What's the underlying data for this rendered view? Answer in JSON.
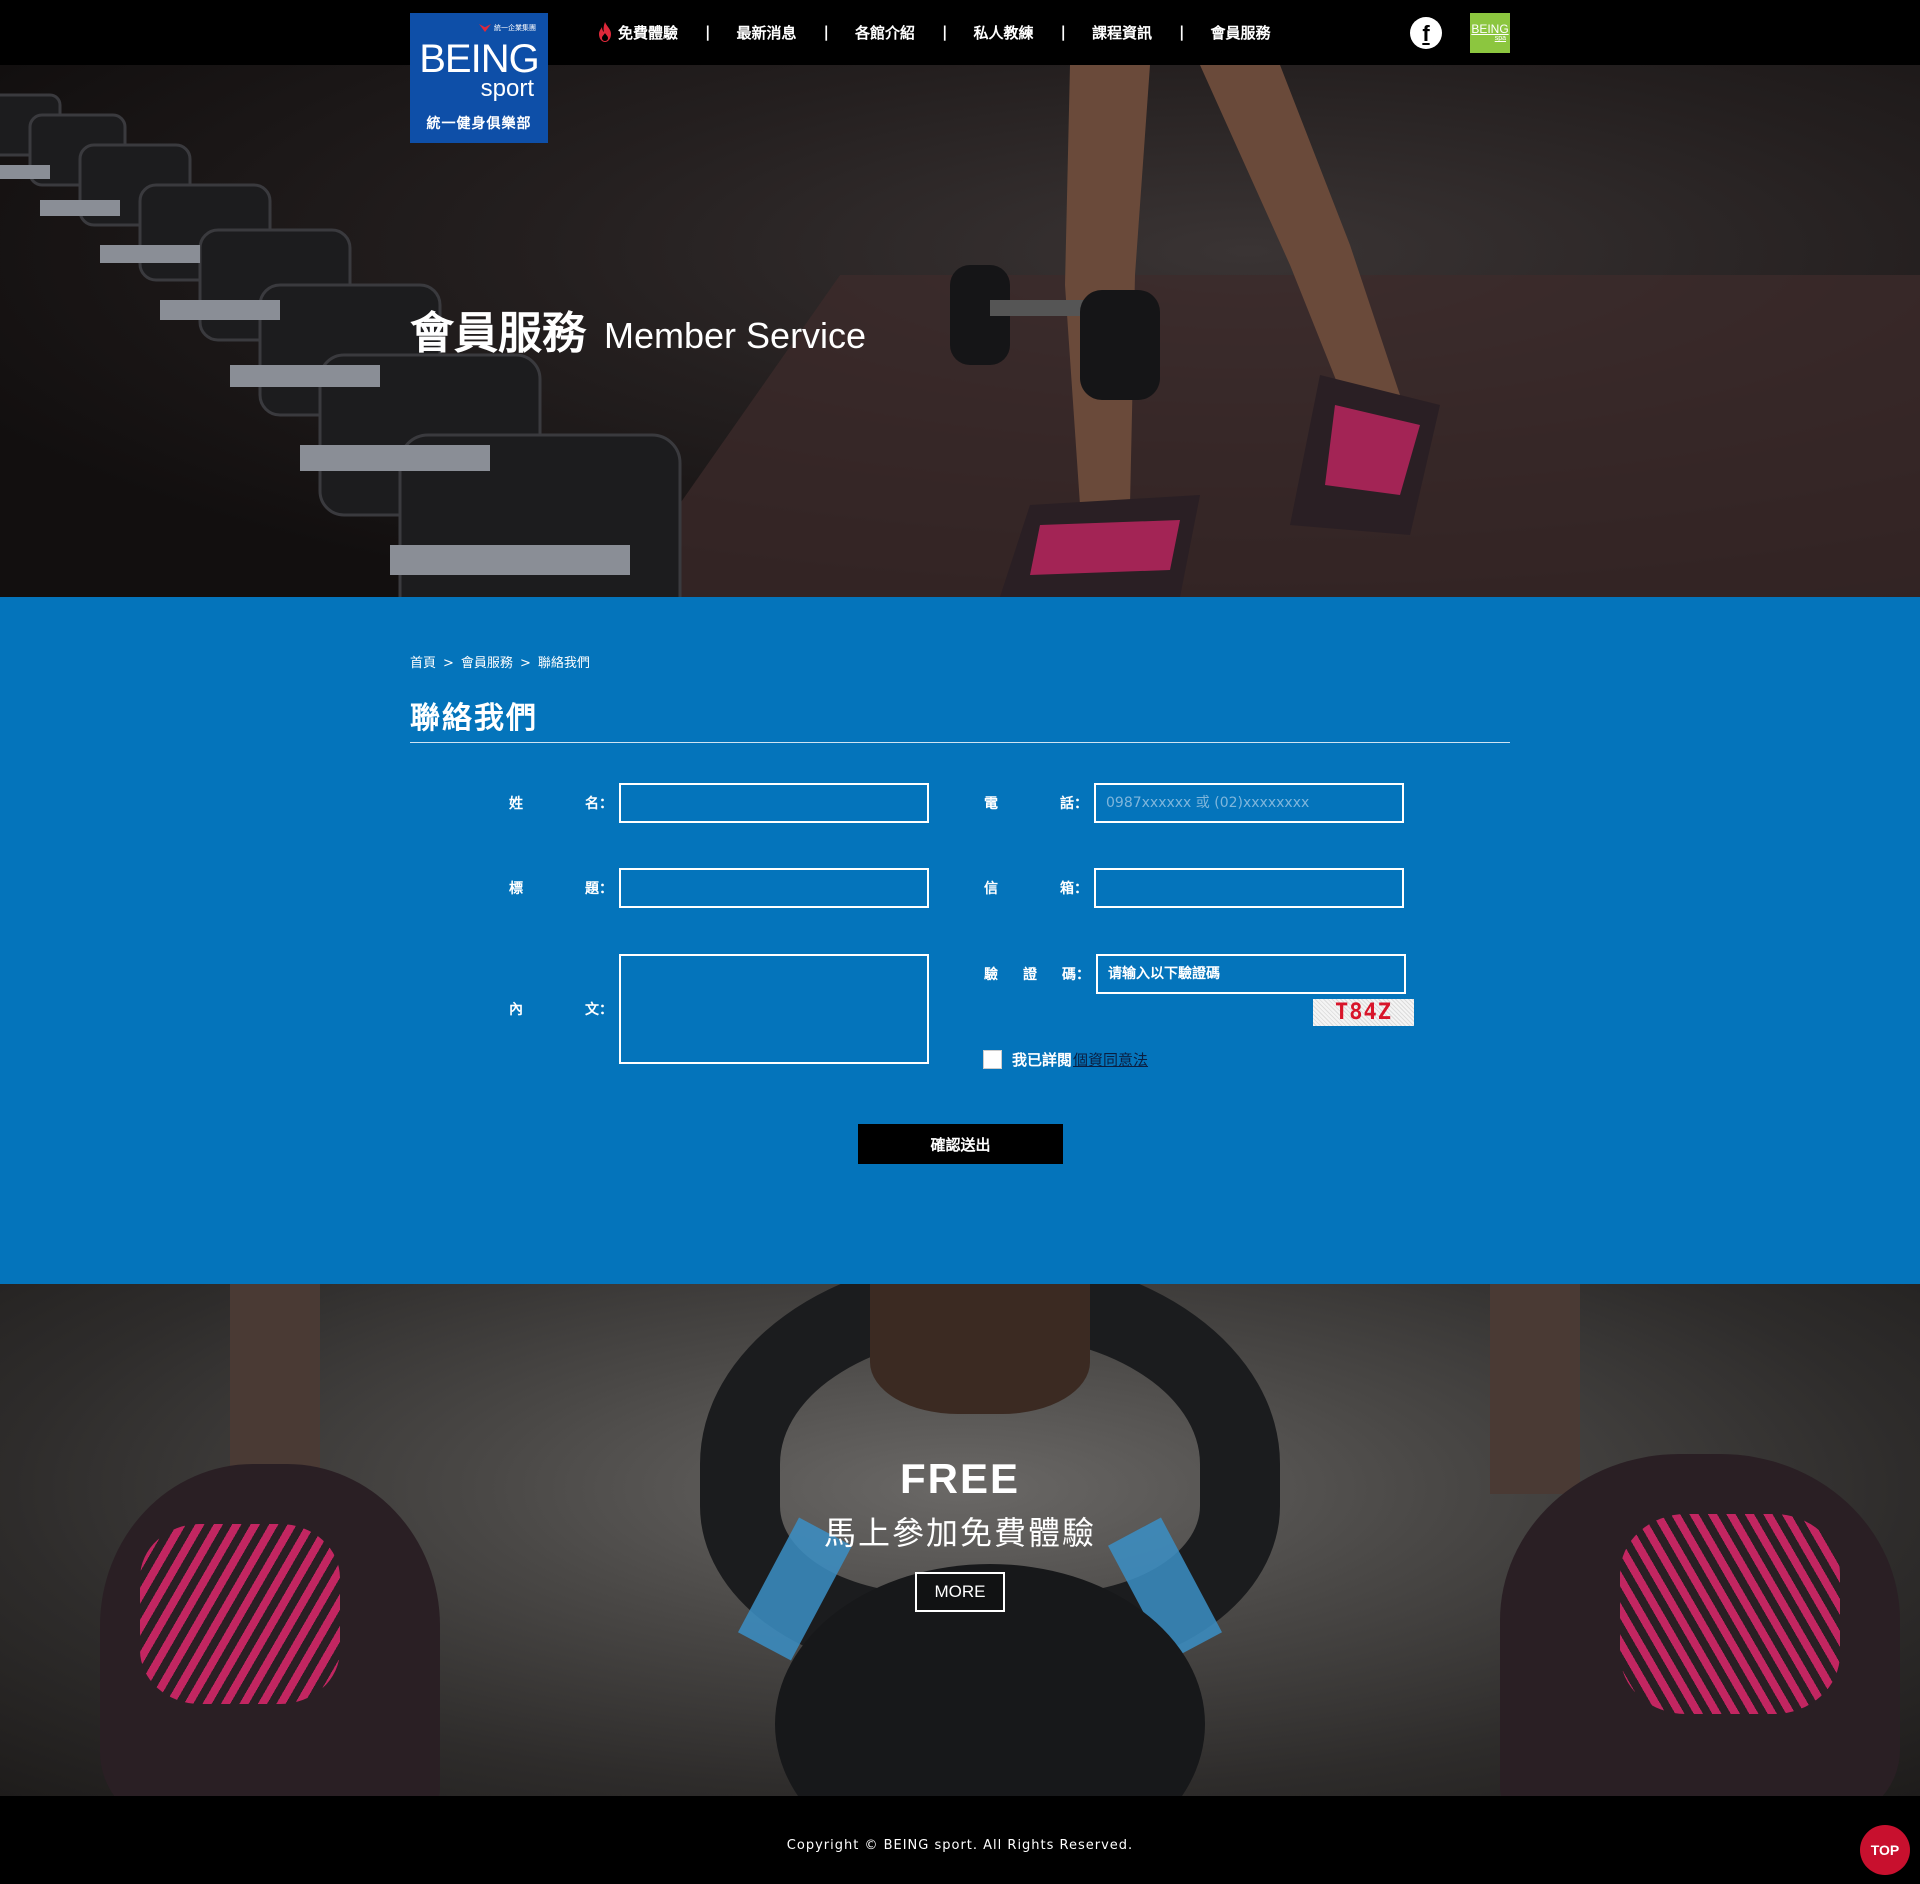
{
  "header": {
    "logo": {
      "group": "統一企業集團",
      "brand": "BEING",
      "sub": "sport",
      "tagline": "統一健身俱樂部"
    },
    "nav": [
      {
        "label": "免費體驗",
        "icon": "flame-icon"
      },
      {
        "label": "最新消息"
      },
      {
        "label": "各館介紹"
      },
      {
        "label": "私人教練"
      },
      {
        "label": "課程資訊"
      },
      {
        "label": "會員服務"
      }
    ],
    "separator": "|",
    "social": {
      "facebook": "f",
      "spa_brand": "BEING",
      "spa_sub": "spa"
    },
    "colors": {
      "accent": "#e0283a",
      "spa": "#8cc63f",
      "logo_bg": "#0e4fa8"
    }
  },
  "hero": {
    "title_zh": "會員服務",
    "title_en": "Member Service"
  },
  "breadcrumb": {
    "items": [
      "首頁",
      "會員服務",
      "聯絡我們"
    ],
    "separator": ">"
  },
  "form": {
    "title": "聯絡我們",
    "name": {
      "label_a": "姓",
      "label_b": "名：",
      "value": ""
    },
    "phone": {
      "label_a": "電",
      "label_b": "話：",
      "placeholder": "0987xxxxxx 或 (02)xxxxxxxx"
    },
    "subject": {
      "label_a": "標",
      "label_b": "題：",
      "value": ""
    },
    "email": {
      "label_a": "信",
      "label_b": "箱：",
      "value": ""
    },
    "content": {
      "label_a": "內",
      "label_b": "文：",
      "value": ""
    },
    "captcha": {
      "label_a": "驗",
      "label_m": "證",
      "label_b": "碼：",
      "placeholder": "请输入以下驗證碼",
      "image_text": "T84Z"
    },
    "agree": {
      "text": "我已詳閱",
      "link": "個資同意法"
    },
    "submit": "確認送出",
    "colors": {
      "section_bg": "#0474bb"
    }
  },
  "free": {
    "word": "FREE",
    "subtitle": "馬上參加免費體驗",
    "more": "MORE"
  },
  "footer": {
    "copyright": "Copyright © BEING sport. All Rights Reserved.",
    "top": "TOP",
    "top_color": "#c8102e"
  }
}
